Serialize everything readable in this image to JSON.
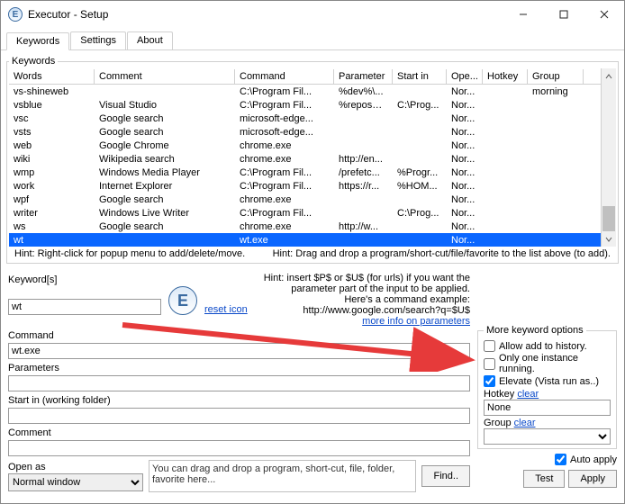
{
  "window": {
    "title": "Executor - Setup"
  },
  "tabs": [
    "Keywords",
    "Settings",
    "About"
  ],
  "active_tab": 0,
  "fieldset_label": "Keywords",
  "columns": [
    "Words",
    "Comment",
    "Command",
    "Parameter",
    "Start in",
    "Ope...",
    "Hotkey",
    "Group"
  ],
  "rows": [
    {
      "words": "vs-shineweb",
      "comment": "",
      "command": "C:\\Program Fil...",
      "param": "%dev%\\...",
      "start": "",
      "open": "Nor...",
      "hotkey": "",
      "group": "morning"
    },
    {
      "words": "vsblue",
      "comment": "Visual Studio",
      "command": "C:\\Program Fil...",
      "param": "%repos%...",
      "start": "C:\\Prog...",
      "open": "Nor...",
      "hotkey": "",
      "group": ""
    },
    {
      "words": "vsc",
      "comment": "Google search",
      "command": "microsoft-edge...",
      "param": "",
      "start": "",
      "open": "Nor...",
      "hotkey": "",
      "group": ""
    },
    {
      "words": "vsts",
      "comment": "Google search",
      "command": "microsoft-edge...",
      "param": "",
      "start": "",
      "open": "Nor...",
      "hotkey": "",
      "group": ""
    },
    {
      "words": "web",
      "comment": "Google Chrome",
      "command": "chrome.exe",
      "param": "",
      "start": "",
      "open": "Nor...",
      "hotkey": "",
      "group": ""
    },
    {
      "words": "wiki",
      "comment": "Wikipedia search",
      "command": "chrome.exe",
      "param": "http://en...",
      "start": "",
      "open": "Nor...",
      "hotkey": "",
      "group": ""
    },
    {
      "words": "wmp",
      "comment": "Windows Media Player",
      "command": "C:\\Program Fil...",
      "param": "/prefetc...",
      "start": "%Progr...",
      "open": "Nor...",
      "hotkey": "",
      "group": ""
    },
    {
      "words": "work",
      "comment": "Internet Explorer",
      "command": "C:\\Program Fil...",
      "param": "https://r...",
      "start": "%HOM...",
      "open": "Nor...",
      "hotkey": "",
      "group": ""
    },
    {
      "words": "wpf",
      "comment": "Google search",
      "command": "chrome.exe",
      "param": "",
      "start": "",
      "open": "Nor...",
      "hotkey": "",
      "group": ""
    },
    {
      "words": "writer",
      "comment": "Windows Live Writer",
      "command": "C:\\Program Fil...",
      "param": "",
      "start": "C:\\Prog...",
      "open": "Nor...",
      "hotkey": "",
      "group": ""
    },
    {
      "words": "ws",
      "comment": "Google search",
      "command": "chrome.exe",
      "param": "http://w...",
      "start": "",
      "open": "Nor...",
      "hotkey": "",
      "group": ""
    },
    {
      "words": "wt",
      "comment": "",
      "command": "wt.exe",
      "param": "",
      "start": "",
      "open": "Nor...",
      "hotkey": "",
      "group": ""
    }
  ],
  "selected_row": 11,
  "hint_left": "Hint: Right-click for popup menu to add/delete/move.",
  "hint_right": "Hint: Drag and drop a program/short-cut/file/favorite to the list above (to add).",
  "form": {
    "keyword_label": "Keyword[s]",
    "keyword_value": "wt",
    "reset_icon": "reset icon",
    "hint_insert": "Hint: insert $P$ or $U$ (for urls) if you want the parameter part of the input to be applied.",
    "hint_example": "Here's a command example: http://www.google.com/search?q=$U$",
    "more_info": "more info on parameters",
    "command_label": "Command",
    "command_value": "wt.exe",
    "parameters_label": "Parameters",
    "parameters_value": "",
    "startin_label": "Start in (working folder)",
    "startin_value": "",
    "comment_label": "Comment",
    "comment_value": "",
    "openas_label": "Open as",
    "openas_value": "Normal window",
    "drag_hint": "You can drag and drop a program, short-cut, file, folder, favorite here...",
    "find_btn": "Find..",
    "test_btn": "Test",
    "apply_btn": "Apply",
    "auto_apply": "Auto apply"
  },
  "options": {
    "legend": "More keyword options",
    "allow_history": "Allow add to history.",
    "only_one": "Only one instance running.",
    "elevate": "Elevate (Vista run as..)",
    "hotkey_label": "Hotkey",
    "clear": "clear",
    "hotkey_value": "None",
    "group_label": "Group",
    "group_value": ""
  }
}
